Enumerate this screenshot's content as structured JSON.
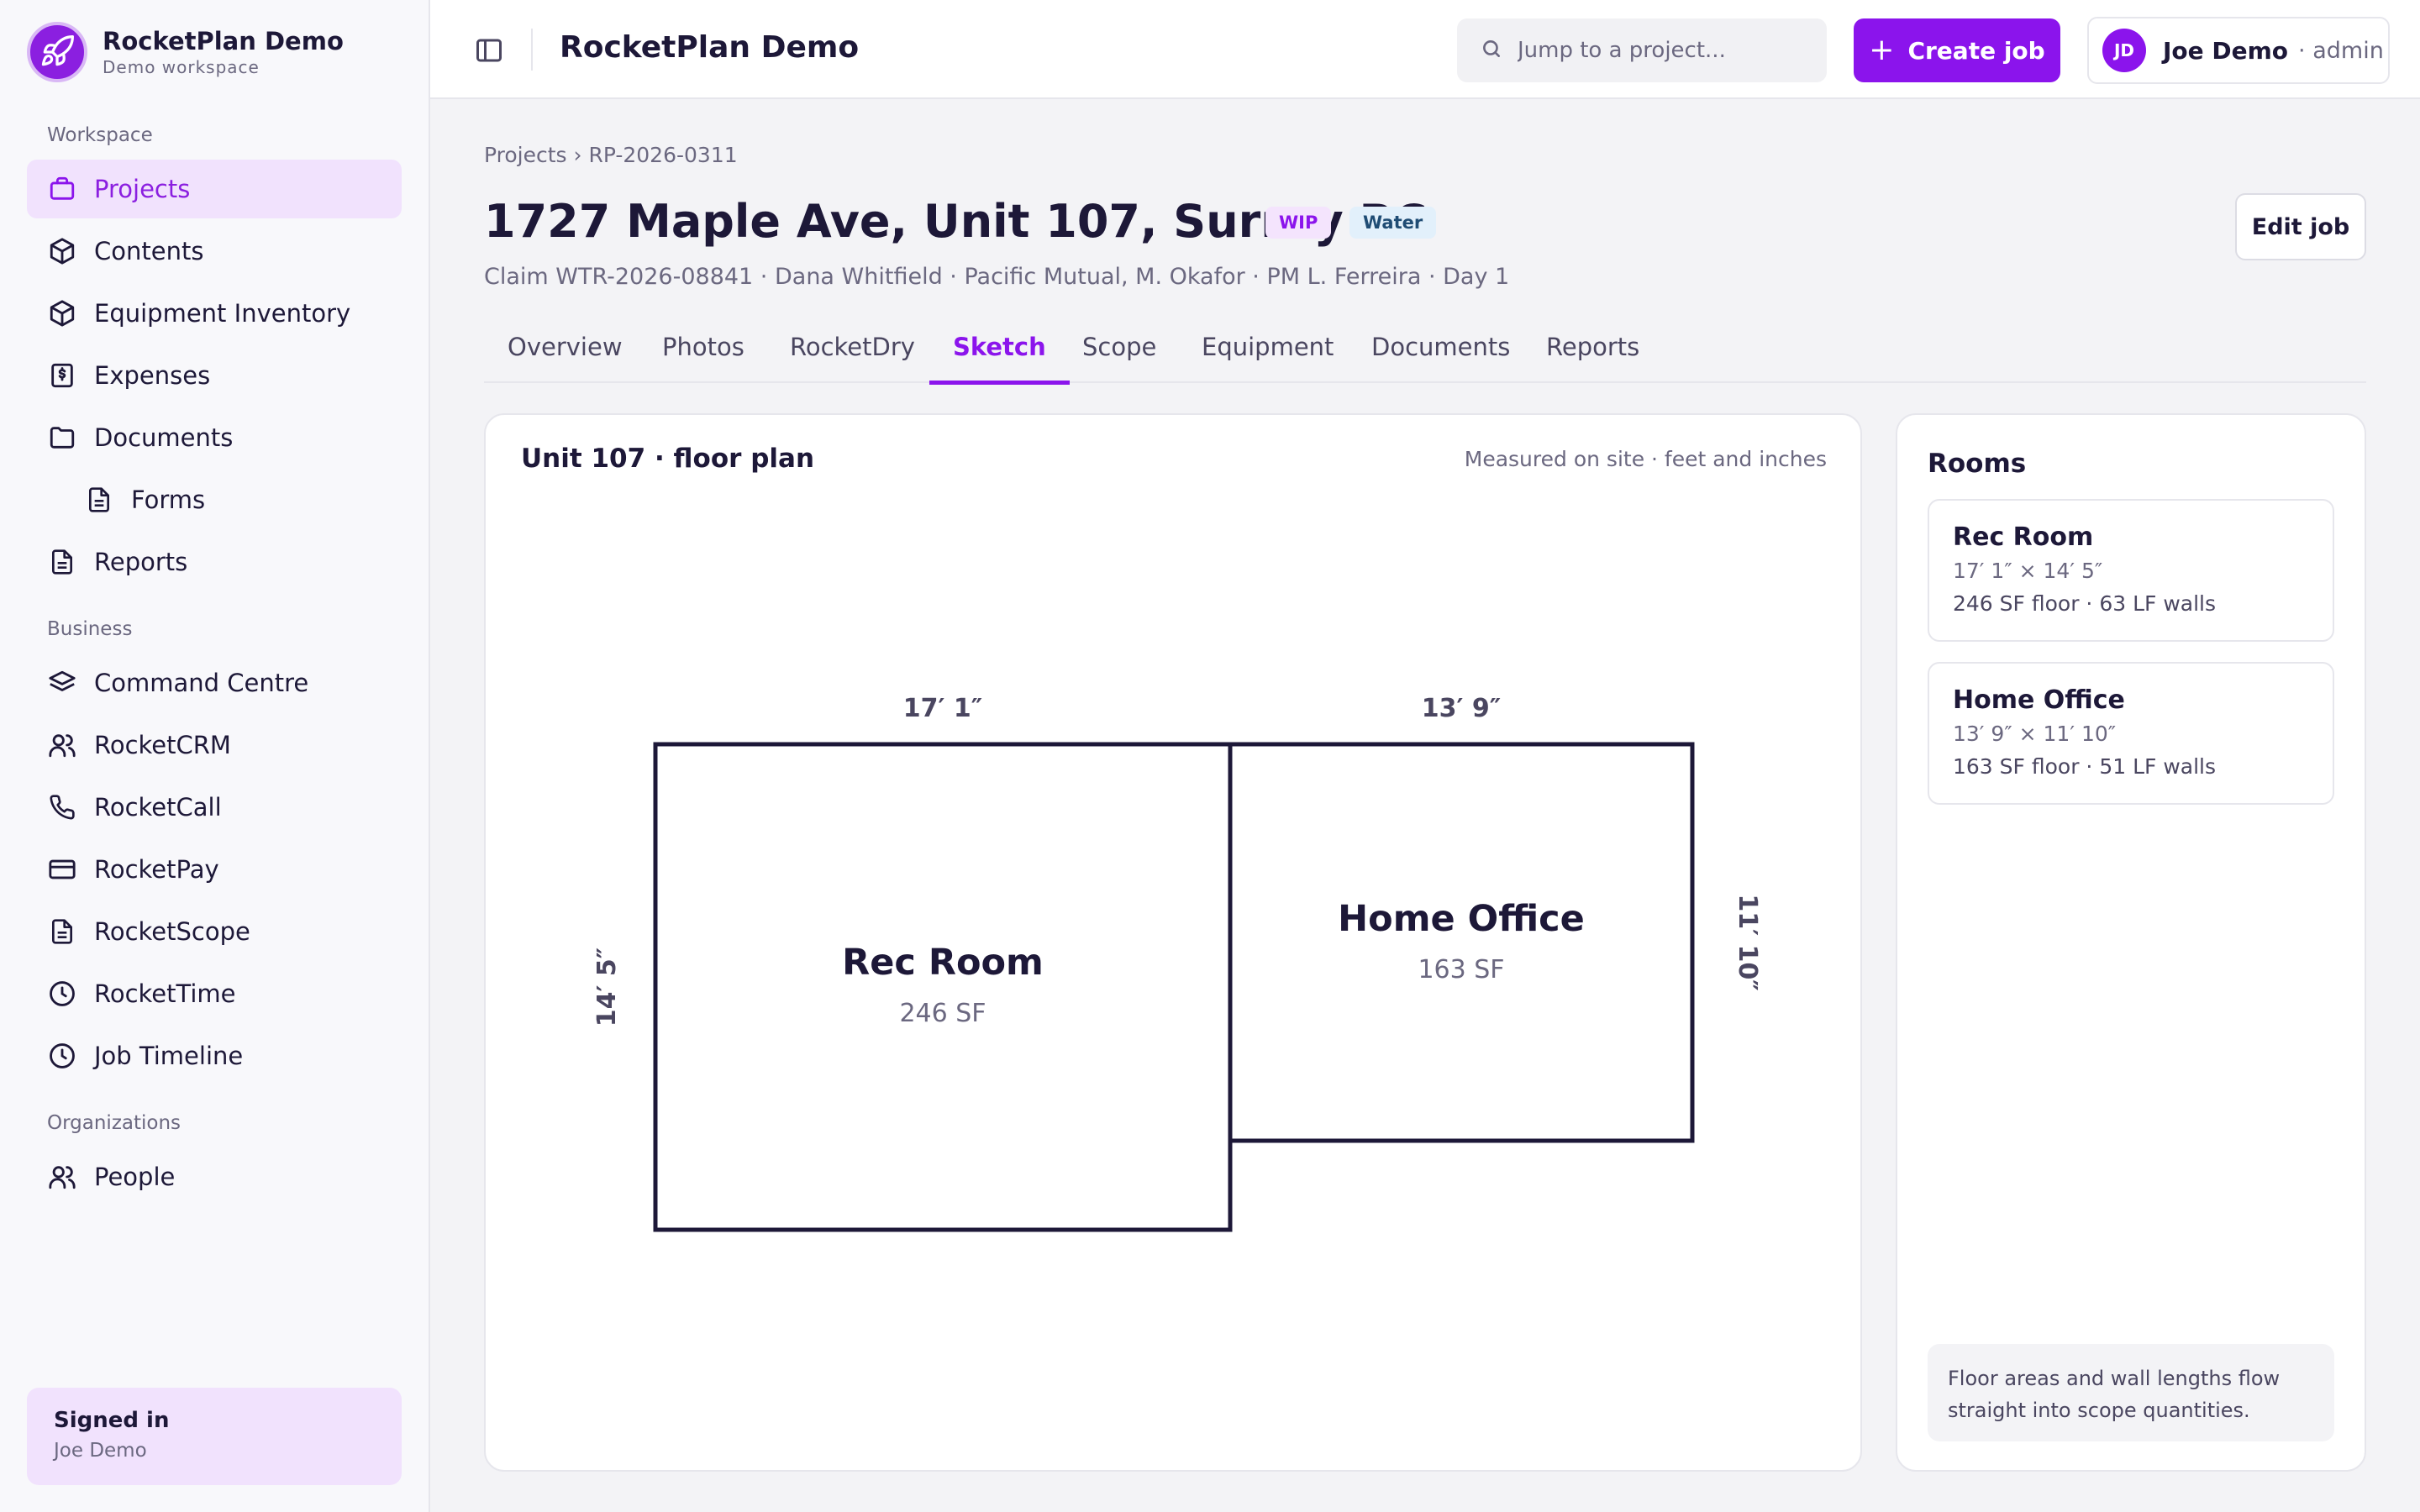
{
  "brand": {
    "name": "RocketPlan Demo",
    "subtitle": "Demo workspace"
  },
  "sidebar": {
    "workspace_label": "Workspace",
    "business_label": "Business",
    "organizations_label": "Organizations",
    "workspace_items": [
      {
        "label": "Projects",
        "icon": "briefcase-icon",
        "active": true
      },
      {
        "label": "Contents",
        "icon": "box-icon"
      },
      {
        "label": "Equipment Inventory",
        "icon": "box-icon"
      },
      {
        "label": "Expenses",
        "icon": "receipt-icon"
      },
      {
        "label": "Documents",
        "icon": "folder-icon"
      },
      {
        "label": "Forms",
        "icon": "file-icon"
      },
      {
        "label": "Reports",
        "icon": "file-icon"
      }
    ],
    "business_items": [
      {
        "label": "Command Centre",
        "icon": "layers-icon"
      },
      {
        "label": "RocketCRM",
        "icon": "users-icon"
      },
      {
        "label": "RocketCall",
        "icon": "phone-icon"
      },
      {
        "label": "RocketPay",
        "icon": "credit-card-icon"
      },
      {
        "label": "RocketScope",
        "icon": "file-icon"
      },
      {
        "label": "RocketTime",
        "icon": "clock-icon"
      },
      {
        "label": "Job Timeline",
        "icon": "clock-icon"
      }
    ],
    "organization_items": [
      {
        "label": "People",
        "icon": "users-icon"
      }
    ],
    "signed_in": {
      "title": "Signed in",
      "name": "Joe Demo"
    }
  },
  "topbar": {
    "title": "RocketPlan Demo",
    "search_placeholder": "Jump to a project...",
    "create_label": "Create job",
    "user": {
      "initials": "JD",
      "name": "Joe Demo",
      "role": "· admin"
    }
  },
  "project": {
    "breadcrumb": "Projects › RP-2026-0311",
    "title": "1727 Maple Ave, Unit 107, Surrey BC",
    "badges": {
      "status": "WIP",
      "loss_type": "Water"
    },
    "subline": "Claim WTR-2026-08841 · Dana Whitfield · Pacific Mutual, M. Okafor · PM L. Ferreira · Day 1",
    "edit_label": "Edit job"
  },
  "tabs": [
    "Overview",
    "Photos",
    "RocketDry",
    "Sketch",
    "Scope",
    "Equipment",
    "Documents",
    "Reports"
  ],
  "active_tab": "Sketch",
  "sketch": {
    "title": "Unit 107 · floor plan",
    "note": "Measured on site · feet and inches",
    "rooms": [
      {
        "name": "Rec Room",
        "area": "246 SF",
        "width_label": "17′ 1″",
        "depth_label": "14′ 5″"
      },
      {
        "name": "Home Office",
        "area": "163 SF",
        "width_label": "13′ 9″",
        "depth_label": "11′ 10″"
      }
    ]
  },
  "rooms_panel": {
    "title": "Rooms",
    "rooms": [
      {
        "name": "Rec Room",
        "dims": "17′ 1″ × 14′ 5″",
        "stats": "246 SF floor · 63 LF walls"
      },
      {
        "name": "Home Office",
        "dims": "13′ 9″ × 11′ 10″",
        "stats": "163 SF floor · 51 LF walls"
      }
    ],
    "note": "Floor areas and wall lengths flow straight into scope quantities."
  },
  "colors": {
    "accent": "#8b14ec",
    "ink": "#1d1838",
    "muted": "#6b6880"
  }
}
